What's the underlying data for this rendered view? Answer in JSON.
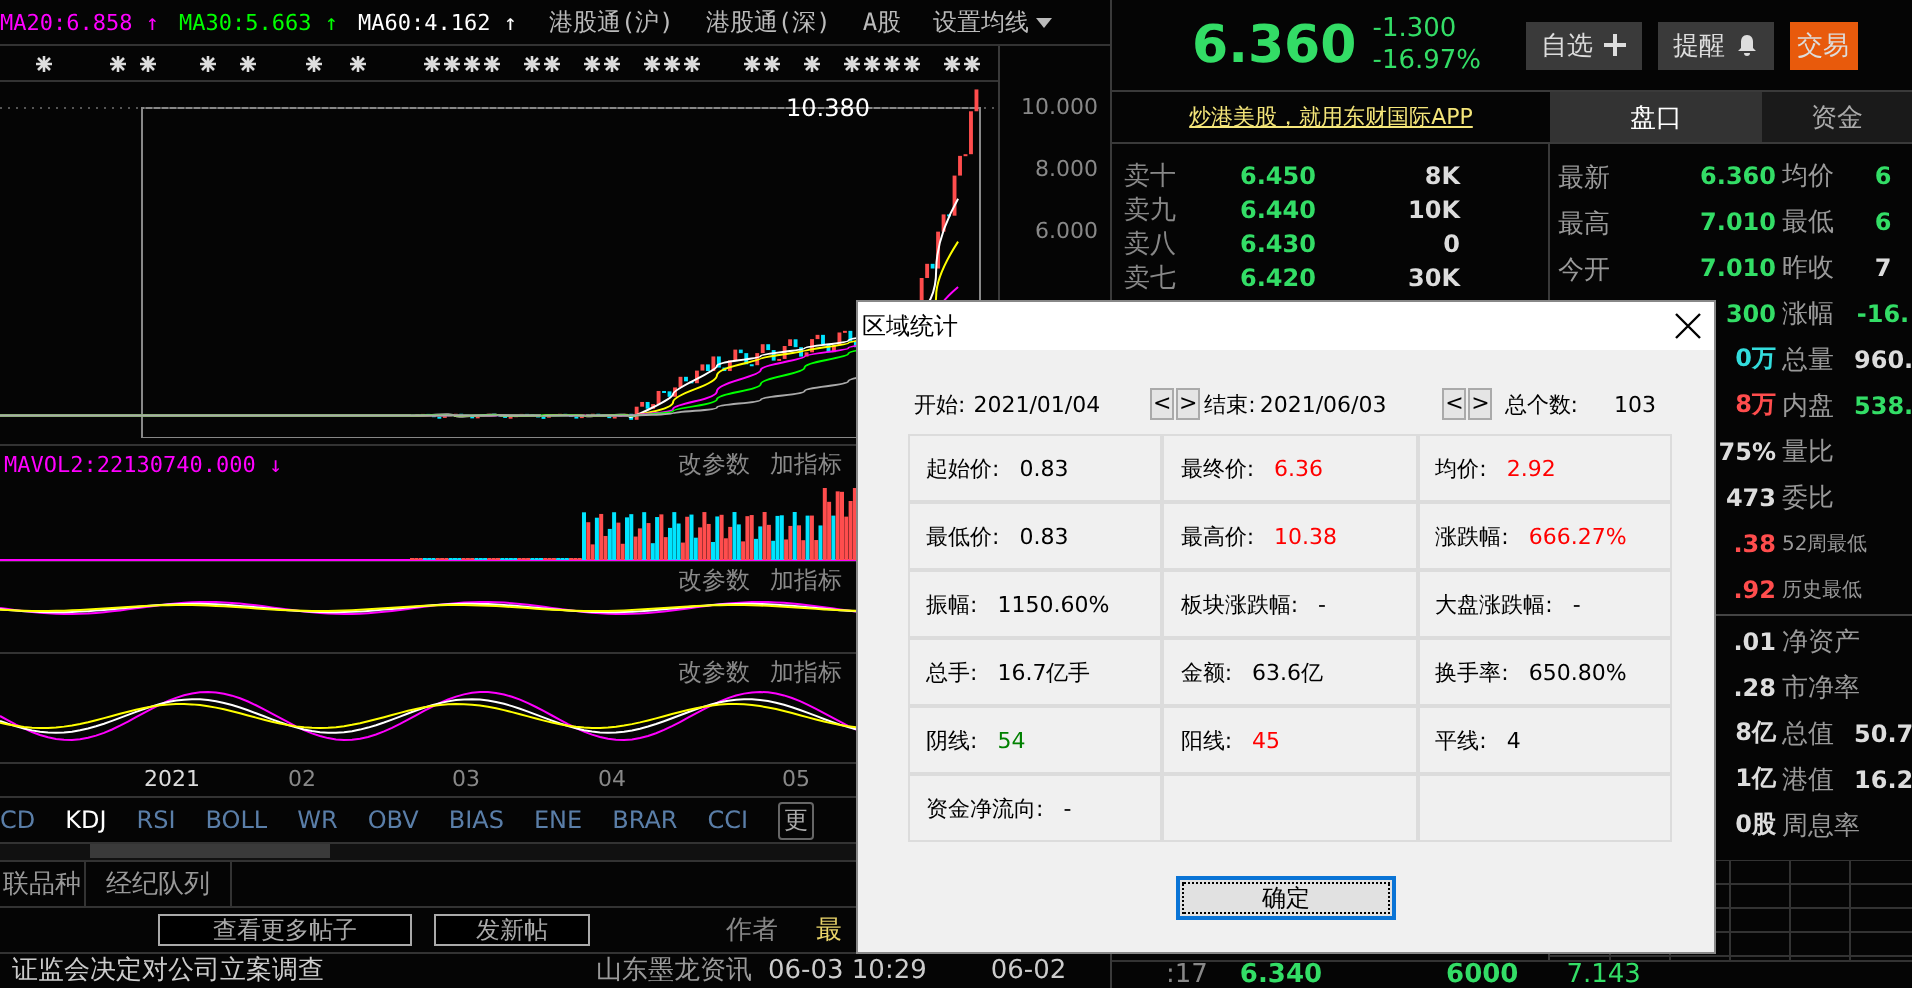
{
  "chart_header": {
    "indicators": [
      {
        "text": "MA20:6.858 ↑",
        "color": "#ff00ff"
      },
      {
        "text": "MA30:5.663 ↑",
        "color": "#00ff00"
      },
      {
        "text": "MA60:4.162 ↑",
        "color": "#ffffff"
      }
    ],
    "tabs": [
      "港股通(沪)",
      "港股通(深)",
      "A股"
    ],
    "menu": "设置均线"
  },
  "main_chart": {
    "high_label": "10.380",
    "axis": [
      "10.000",
      "8.000",
      "6.000"
    ]
  },
  "volume_panel": {
    "legend": "MAVOL2:22130740.000 ↓",
    "actions": [
      "改参数",
      "加指标"
    ]
  },
  "panels": [
    {
      "actions": [
        "改参数",
        "加指标"
      ]
    },
    {
      "actions": [
        "改参数",
        "加指标"
      ]
    }
  ],
  "x_axis": [
    "2021",
    "02",
    "03",
    "04",
    "05"
  ],
  "indicator_tabs": [
    {
      "label": "CD",
      "selected": false
    },
    {
      "label": "KDJ",
      "selected": true
    },
    {
      "label": "RSI",
      "selected": false
    },
    {
      "label": "BOLL",
      "selected": false
    },
    {
      "label": "WR",
      "selected": false
    },
    {
      "label": "OBV",
      "selected": false
    },
    {
      "label": "BIAS",
      "selected": false
    },
    {
      "label": "ENE",
      "selected": false
    },
    {
      "label": "BRAR",
      "selected": false
    },
    {
      "label": "CCI",
      "selected": false
    }
  ],
  "more_tab": "更",
  "bottom_tabs": [
    "联品种",
    "经纪队列"
  ],
  "forum": {
    "buttons": [
      "查看更多帖子",
      "发新帖"
    ],
    "columns": [
      "作者",
      "最"
    ]
  },
  "news": [
    {
      "title": "证监会决定对公司立案调查",
      "source": "山东墨龙资讯",
      "time": "06-03 10:29",
      "date": "06-02"
    }
  ],
  "quote": {
    "price": "6.360",
    "change": "-1.300",
    "change_pct": "-16.97%",
    "buttons": [
      {
        "label": "自选",
        "kind": "plus"
      },
      {
        "label": "提醒",
        "kind": "bell"
      },
      {
        "label": "交易",
        "kind": "primary"
      }
    ]
  },
  "promo_link": "炒港美股，就用东财国际APP",
  "side_tabs": [
    {
      "label": "盘口",
      "selected": true
    },
    {
      "label": "资金",
      "selected": false
    }
  ],
  "order_book": [
    {
      "label": "卖十",
      "price": "6.450",
      "volume": "8K"
    },
    {
      "label": "卖九",
      "price": "6.440",
      "volume": "10K"
    },
    {
      "label": "卖八",
      "price": "6.430",
      "volume": "0"
    },
    {
      "label": "卖七",
      "price": "6.420",
      "volume": "30K"
    }
  ],
  "quote_rows": [
    {
      "left": {
        "label": "最新",
        "value": "6.360",
        "color": "#33dd66"
      },
      "right": {
        "label": "均价",
        "value": "6",
        "color": "#33dd66"
      }
    },
    {
      "left": {
        "label": "最高",
        "value": "7.010",
        "color": "#33dd66"
      },
      "right": {
        "label": "最低",
        "value": "6",
        "color": "#33dd66"
      }
    },
    {
      "left": {
        "label": "今开",
        "value": "7.010",
        "color": "#33dd66"
      },
      "right": {
        "label": "昨收",
        "value": "7",
        "color": "#dddddd"
      }
    },
    {
      "left": {
        "value": "300",
        "color": "#33dd66"
      },
      "right": {
        "label": "涨幅",
        "value": "-16.",
        "color": "#33dd66"
      }
    },
    {
      "left": {
        "value": "0万",
        "color": "#33dddd"
      },
      "right": {
        "label": "总量",
        "value": "960.",
        "color": "#dddddd"
      }
    },
    {
      "left": {
        "value": "8万",
        "color": "#ff4d4d"
      },
      "right": {
        "label": "内盘",
        "value": "538.",
        "color": "#33dd66"
      }
    },
    {
      "left": {
        "value": "75%",
        "color": "#dddddd"
      },
      "right": {
        "label": "量比"
      }
    },
    {
      "left": {
        "value": "473",
        "color": "#dddddd"
      },
      "right": {
        "label": "委比"
      }
    },
    {
      "left": {
        "value": ".38",
        "color": "#ff4d4d"
      },
      "right": {
        "label": "52周最低"
      }
    },
    {
      "left": {
        "value": ".92",
        "color": "#ff4d4d"
      },
      "right": {
        "label": "历史最低"
      }
    },
    {
      "left": {
        "value": ".01",
        "color": "#dddddd"
      },
      "right": {
        "label": "净资产"
      }
    },
    {
      "left": {
        "value": ".28",
        "color": "#dddddd"
      },
      "right": {
        "label": "市净率"
      }
    },
    {
      "left": {
        "value": "8亿",
        "color": "#dddddd"
      },
      "right": {
        "label": "总值",
        "value": "50.7",
        "color": "#dddddd"
      }
    },
    {
      "left": {
        "value": "1亿",
        "color": "#dddddd"
      },
      "right": {
        "label": "港值",
        "value": "16.2",
        "color": "#dddddd"
      }
    },
    {
      "left": {
        "value": "0股",
        "color": "#dddddd"
      },
      "right": {
        "label": "周息率"
      }
    }
  ],
  "trade_row": {
    "time": ":17",
    "price": "6.340",
    "volume": "6000",
    "amount": "7.143"
  },
  "dialog": {
    "title": "区域统计",
    "range": {
      "start_label": "开始:",
      "start": "2021/01/04",
      "start_nav": [
        "<",
        ">"
      ],
      "end_label": "结束:",
      "end": "2021/06/03",
      "end_nav": [
        "<",
        ">"
      ],
      "count_label": "总个数:",
      "count": "103"
    },
    "cells": [
      {
        "kind": "stat",
        "label": "起始价:",
        "value": "0.83",
        "color": "#000000"
      },
      {
        "kind": "stat",
        "label": "最终价:",
        "value": "6.36",
        "color": "#ff0000"
      },
      {
        "kind": "stat",
        "label": "均价:",
        "value": "2.92",
        "color": "#ff0000"
      },
      {
        "kind": "stat",
        "label": "最低价:",
        "value": "0.83",
        "color": "#000000"
      },
      {
        "kind": "stat",
        "label": "最高价:",
        "value": "10.38",
        "color": "#ff0000"
      },
      {
        "kind": "stat",
        "label": "涨跌幅:",
        "value": "666.27%",
        "color": "#ff0000"
      },
      {
        "kind": "stat",
        "label": "振幅:",
        "value": "1150.60%",
        "color": "#000000"
      },
      {
        "kind": "stat",
        "label": "板块涨跌幅:",
        "value": "-"
      },
      {
        "kind": "stat",
        "label": "大盘涨跌幅:",
        "value": "-"
      },
      {
        "kind": "stat",
        "label": "总手:",
        "value": "16.7亿手",
        "color": "#000000"
      },
      {
        "kind": "stat",
        "label": "金额:",
        "value": "63.6亿",
        "color": "#000000"
      },
      {
        "kind": "stat",
        "label": "换手率:",
        "value": "650.80%",
        "color": "#000000"
      },
      {
        "kind": "stat",
        "label": "阴线:",
        "value": "54",
        "color": "#008000"
      },
      {
        "kind": "stat",
        "label": "阳线:",
        "value": "45",
        "color": "#ff0000"
      },
      {
        "kind": "stat",
        "label": "平线:",
        "value": "4",
        "color": "#000000"
      },
      {
        "kind": "stat",
        "label": "资金净流向:",
        "value": "-"
      },
      {
        "kind": "empty"
      },
      {
        "kind": "empty"
      }
    ],
    "ok_button": "确定"
  }
}
